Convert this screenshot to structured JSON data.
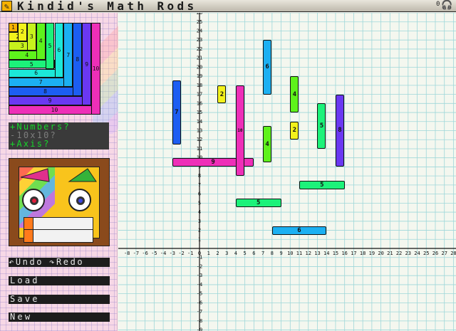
{
  "app": {
    "title": "Kindid's Math Rods",
    "count": "0",
    "pencil_icon": "pencil-icon",
    "headphones_icon": "headphones-icon"
  },
  "staircase": [
    {
      "n": "1",
      "color": "#f6b100"
    },
    {
      "n": "2",
      "color": "#f2f21c"
    },
    {
      "n": "3",
      "color": "#c7f21c"
    },
    {
      "n": "4",
      "color": "#5ef21c"
    },
    {
      "n": "5",
      "color": "#1cf27a"
    },
    {
      "n": "6",
      "color": "#1ce8d8"
    },
    {
      "n": "7",
      "color": "#1cb0f2"
    },
    {
      "n": "8",
      "color": "#1c5ef2"
    },
    {
      "n": "9",
      "color": "#6a38f2"
    },
    {
      "n": "10",
      "color": "#ee2fb8"
    }
  ],
  "toggles": [
    {
      "label": "+Numbers?",
      "on": true
    },
    {
      "label": "-10x10?",
      "on": false
    },
    {
      "label": "+Axis?",
      "on": true
    }
  ],
  "buttons": {
    "undo": "↶Undo",
    "redo": "↷Redo",
    "load": "Load",
    "save": "Save",
    "new": "New"
  },
  "grid": {
    "x_ticks": [
      "-8",
      "-7",
      "-6",
      "-5",
      "-4",
      "-3",
      "-2",
      "-1",
      "0",
      "1",
      "2",
      "3",
      "4",
      "5",
      "6",
      "7",
      "8",
      "9",
      "10",
      "11",
      "12",
      "13",
      "14",
      "15",
      "16",
      "17",
      "18",
      "19",
      "20",
      "21",
      "22",
      "23",
      "24",
      "25",
      "26",
      "27",
      "28"
    ],
    "y_ticks": [
      "26",
      "25",
      "24",
      "23",
      "22",
      "21",
      "20",
      "19",
      "18",
      "17",
      "16",
      "15",
      "14",
      "13",
      "12",
      "11",
      "10",
      "9",
      "8",
      "7",
      "6",
      "5",
      "4",
      "3",
      "2",
      "1",
      "0",
      "-1",
      "-2",
      "-3",
      "-4",
      "-5",
      "-6",
      "-7",
      "-8",
      "-9"
    ]
  },
  "rods": [
    {
      "n": "7",
      "orient": "v",
      "x": -3,
      "y": 11.5,
      "color": "#1c5ef2"
    },
    {
      "n": "9",
      "orient": "h",
      "x": -3,
      "y": 9.5,
      "color": "#ee2fb8"
    },
    {
      "n": "10",
      "orient": "v",
      "x": 4,
      "y": 8,
      "color": "#ee2fb8"
    },
    {
      "n": "2",
      "orient": "v",
      "x": 2,
      "y": 16,
      "color": "#f2f21c"
    },
    {
      "n": "6",
      "orient": "v",
      "x": 7,
      "y": 17,
      "color": "#1cb0f2"
    },
    {
      "n": "4",
      "orient": "v",
      "x": 10,
      "y": 15,
      "color": "#5ef21c"
    },
    {
      "n": "4",
      "orient": "v",
      "x": 7,
      "y": 9.5,
      "color": "#5ef21c"
    },
    {
      "n": "2",
      "orient": "v",
      "x": 10,
      "y": 12,
      "color": "#f2f21c"
    },
    {
      "n": "5",
      "orient": "v",
      "x": 13,
      "y": 11,
      "color": "#1cf27a"
    },
    {
      "n": "8",
      "orient": "v",
      "x": 15,
      "y": 9,
      "color": "#6a38f2"
    },
    {
      "n": "5",
      "orient": "h",
      "x": 11,
      "y": 7,
      "color": "#1cf27a"
    },
    {
      "n": "5",
      "orient": "h",
      "x": 4,
      "y": 5,
      "color": "#1cf27a"
    },
    {
      "n": "6",
      "orient": "h",
      "x": 8,
      "y": 2,
      "color": "#1cb0f2"
    }
  ]
}
